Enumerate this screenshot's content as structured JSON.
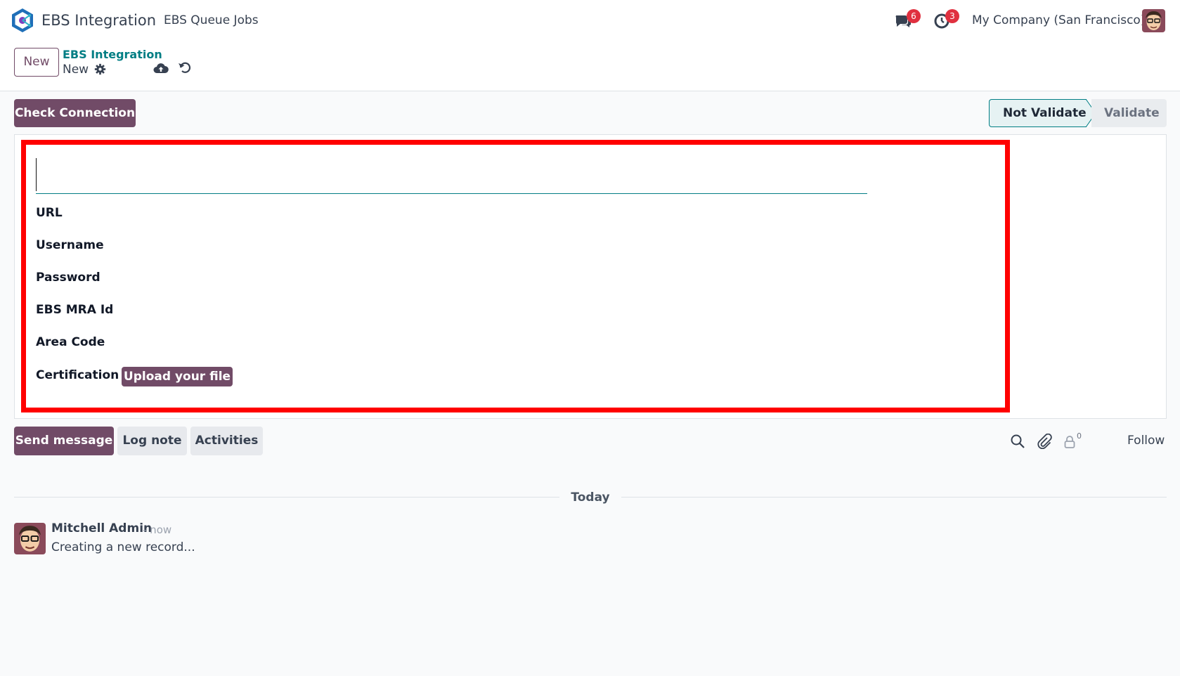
{
  "navbar": {
    "app_name": "EBS Integration",
    "menu_item": "EBS Queue Jobs",
    "messages_count": "6",
    "activities_count": "3",
    "company": "My Company (San Francisco)"
  },
  "control_panel": {
    "new_label": "New",
    "breadcrumb_parent": "EBS Integration",
    "breadcrumb_current": "New"
  },
  "statusbar": {
    "check_connection_label": "Check Connection",
    "stages": [
      "Not Validate",
      "Validate"
    ],
    "active_stage": "Not Validate"
  },
  "form": {
    "name_value": "",
    "fields": [
      {
        "label": "URL",
        "value": ""
      },
      {
        "label": "Username",
        "value": ""
      },
      {
        "label": "Password",
        "value": ""
      },
      {
        "label": "EBS MRA Id",
        "value": ""
      },
      {
        "label": "Area Code",
        "value": ""
      },
      {
        "label": "Certification",
        "value": ""
      }
    ],
    "upload_label": "Upload your file"
  },
  "chatter": {
    "send_message_label": "Send message",
    "log_note_label": "Log note",
    "activities_label": "Activities",
    "followers_count": "0",
    "follow_label": "Follow",
    "date_separator": "Today",
    "messages": [
      {
        "author": "Mitchell Admin",
        "time": "- now",
        "body": "Creating a new record..."
      }
    ]
  },
  "colors": {
    "brand": "#714b67",
    "accent": "#017e84",
    "highlight": "#ff0000",
    "badge": "#e0303f"
  },
  "icons": [
    "app-logo-icon",
    "chat-icon",
    "clock-icon",
    "gear-icon",
    "cloud-upload-icon",
    "undo-icon",
    "search-icon",
    "paperclip-icon",
    "user-icon"
  ]
}
